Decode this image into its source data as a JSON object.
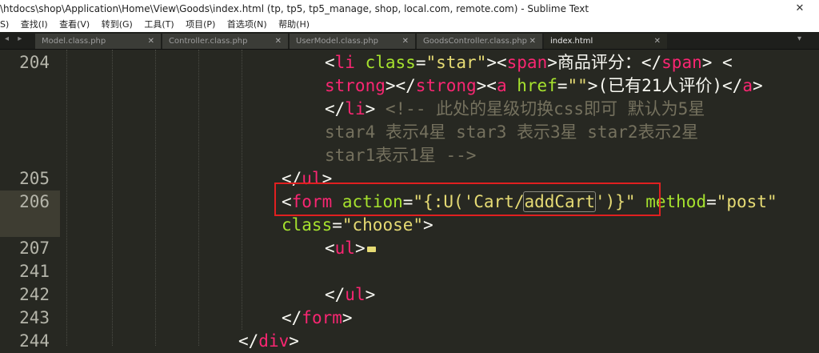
{
  "window": {
    "title": "\\htdocs\\shop\\Application\\Home\\View\\Goods\\index.html (tp, tp5, tp5_manage, shop, local.com, remote.com) - Sublime Text",
    "close_glyph": "✕"
  },
  "menu": [
    "S)",
    "查找(I)",
    "查看(V)",
    "转到(G)",
    "工具(T)",
    "项目(P)",
    "首选项(N)",
    "帮助(H)"
  ],
  "tabs": [
    {
      "label": "Model.class.php",
      "close": "✕"
    },
    {
      "label": "Controller.class.php",
      "close": "✕"
    },
    {
      "label": "UserModel.class.php",
      "close": "✕"
    },
    {
      "label": "GoodsController.class.php",
      "close": "✕"
    },
    {
      "label": "index.html",
      "close": "✕"
    }
  ],
  "tab_nav": "◂ ▸",
  "tab_dropdown": "▾",
  "line_numbers": [
    "204",
    "205",
    "206",
    "207",
    "241",
    "242",
    "243",
    "244"
  ],
  "code": {
    "l204a": {
      "t1": "<",
      "t2": "li",
      "t3": " ",
      "t4": "class",
      "t5": "=",
      "t6": "\"star\"",
      "t7": "><",
      "t8": "span",
      "t9": ">商品评分：</",
      "t10": "span",
      "t11": "> <"
    },
    "l204b": {
      "t1": "strong",
      "t2": "></",
      "t3": "strong",
      "t4": "><",
      "t5": "a",
      "t6": " ",
      "t7": "href",
      "t8": "=",
      "t9": "\"\"",
      "t10": ">(已有21人评价)</",
      "t11": "a",
      "t12": ">"
    },
    "l204c": {
      "t1": "</",
      "t2": "li",
      "t3": "> ",
      "t4": "<!-- 此处的星级切换css即可 默认为5星"
    },
    "l204d": "star4 表示4星 star3 表示3星 star2表示2星",
    "l204e": "star1表示1星 -->",
    "l205": {
      "t1": "</",
      "t2": "ul",
      "t3": ">"
    },
    "l206a": {
      "t1": "<",
      "t2": "form",
      "t3": " ",
      "t4": "action",
      "t5": "=",
      "t6": "\"{:U('Cart/",
      "t7": "addCart",
      "t8": "')}\"",
      "t9": " ",
      "t10": "method",
      "t11": "=",
      "t12": "\"post\""
    },
    "l206b": {
      "t1": "class",
      "t2": "=",
      "t3": "\"choose\"",
      "t4": ">"
    },
    "l207": {
      "t1": "<",
      "t2": "ul",
      "t3": ">"
    },
    "l242": {
      "t1": "</",
      "t2": "ul",
      "t3": ">"
    },
    "l243": {
      "t1": "</",
      "t2": "form",
      "t3": ">"
    },
    "l244": {
      "t1": "</",
      "t2": "div",
      "t3": ">"
    }
  },
  "colors": {
    "background": "#272822",
    "tag": "#f92672",
    "attribute": "#a6e22e",
    "string": "#e6db74",
    "comment": "#75715e",
    "highlight_box": "#e02020"
  }
}
